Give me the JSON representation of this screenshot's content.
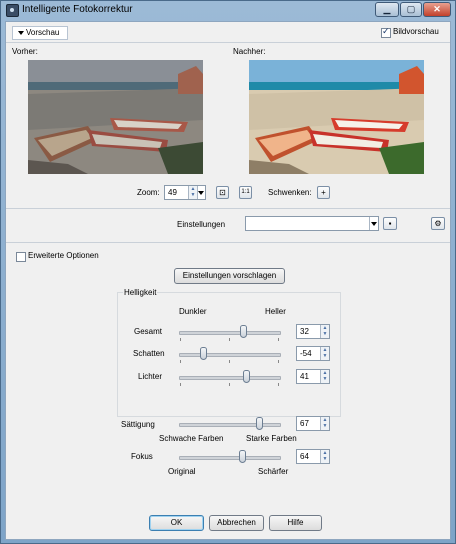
{
  "window": {
    "title": "Intelligente Fotokorrektur",
    "minimize": "▁",
    "maximize": "▢",
    "close": "✕"
  },
  "preview": {
    "tab_label": "Vorschau",
    "preview_checkbox_label": "Bildvorschau",
    "preview_checked": true,
    "before_label": "Vorher:",
    "after_label": "Nachher:"
  },
  "zoom": {
    "label": "Zoom:",
    "value": "49",
    "fit_icon": "fit-window-icon",
    "actual_label": "1:1",
    "pan_label": "Schwenken:",
    "pan_icon": "+"
  },
  "settings": {
    "label": "Einstellungen",
    "value": ""
  },
  "advanced": {
    "label": "Erweiterte Optionen",
    "checked": false
  },
  "suggest_button": "Einstellungen vorschlagen",
  "brightness": {
    "group_label": "Helligkeit",
    "left_label": "Dunkler",
    "right_label": "Heller",
    "sliders": [
      {
        "label": "Gesamt",
        "value": "32"
      },
      {
        "label": "Schatten",
        "value": "-54"
      },
      {
        "label": "Lichter",
        "value": "41"
      }
    ]
  },
  "saturation": {
    "label": "Sättigung",
    "value": "67",
    "left_label": "Schwache Farben",
    "right_label": "Starke Farben"
  },
  "focus": {
    "label": "Fokus",
    "value": "64",
    "left_label": "Original",
    "right_label": "Schärfer"
  },
  "buttons": {
    "ok": "OK",
    "cancel": "Abbrechen",
    "help": "Hilfe"
  },
  "colors": {
    "accent": "#3c7fb1",
    "title_bar": "#9cbad6"
  }
}
